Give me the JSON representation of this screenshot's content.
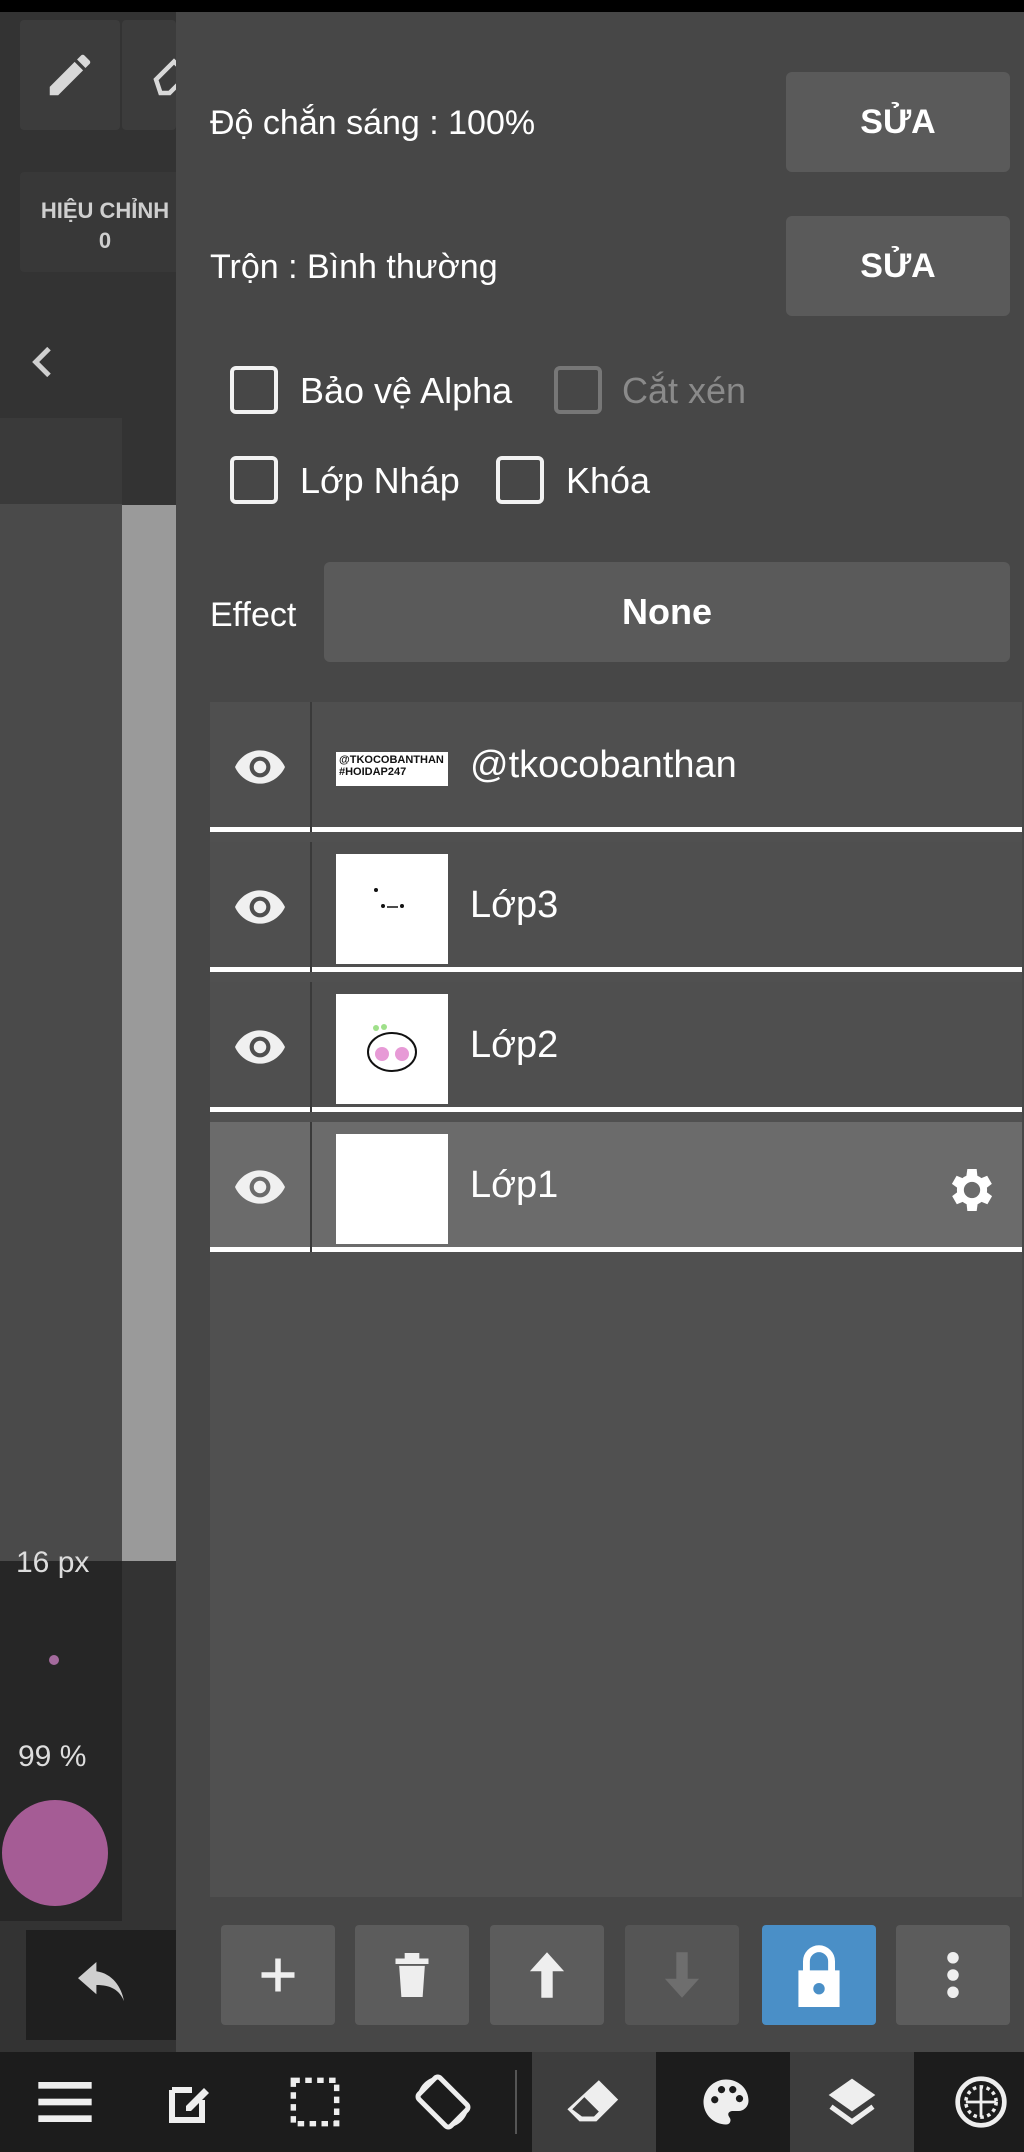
{
  "left": {
    "adjust_label": "HIỆU CHỈNH",
    "adjust_value": "0",
    "brush_size": "16 px",
    "opacity": "99 %",
    "color": "#a55c95"
  },
  "panel": {
    "opacity_label": "Độ chắn sáng : 100%",
    "opacity_edit": "SỬA",
    "blend_label": "Trộn : Bình thường",
    "blend_edit": "SỬA",
    "checkboxes": [
      {
        "label": "Bảo vệ Alpha",
        "checked": false,
        "disabled": false
      },
      {
        "label": "Cắt xén",
        "checked": false,
        "disabled": true
      },
      {
        "label": "Lớp Nháp",
        "checked": false,
        "disabled": false
      },
      {
        "label": "Khóa",
        "checked": false,
        "disabled": false
      }
    ],
    "effect_label": "Effect",
    "effect_value": "None"
  },
  "layers": [
    {
      "name": "@tkocobanthan",
      "thumb_text": "@TKOCOBANTHAN #HOIDAP247",
      "visible": true,
      "selected": false
    },
    {
      "name": "Lớp3",
      "visible": true,
      "selected": false
    },
    {
      "name": "Lớp2",
      "visible": true,
      "selected": false
    },
    {
      "name": "Lớp1",
      "visible": true,
      "selected": true
    }
  ],
  "layer_actions": [
    {
      "icon": "plus-icon"
    },
    {
      "icon": "trash-icon"
    },
    {
      "icon": "arrow-up-icon"
    },
    {
      "icon": "arrow-down-icon",
      "disabled": true
    },
    {
      "icon": "lock-icon",
      "active": true
    },
    {
      "icon": "more-vertical-icon"
    }
  ],
  "bottom_nav": [
    {
      "icon": "menu-icon"
    },
    {
      "icon": "edit-square-icon"
    },
    {
      "icon": "selection-icon"
    },
    {
      "icon": "rotate-screen-icon"
    },
    {
      "icon": "eraser-icon",
      "active": true
    },
    {
      "icon": "palette-icon"
    },
    {
      "icon": "layers-icon",
      "active": true
    },
    {
      "icon": "grid-globe-icon"
    }
  ]
}
